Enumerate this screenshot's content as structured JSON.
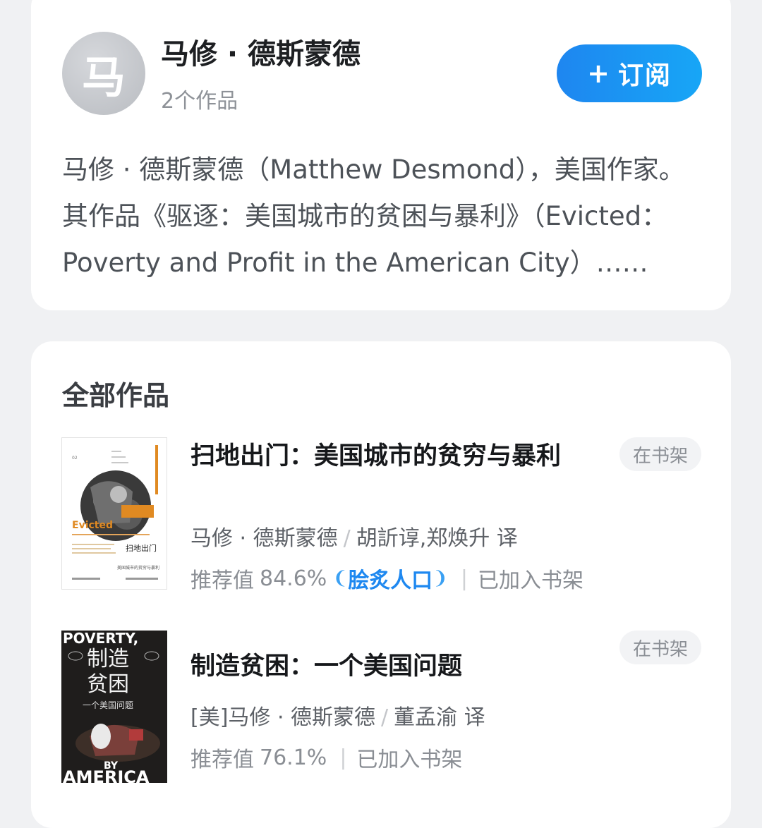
{
  "author": {
    "avatar_text": "马",
    "name": "马修 · 德斯蒙德",
    "work_count": "2个作品",
    "subscribe_plus": "+",
    "subscribe_label": "订阅",
    "bio": "马修 · 德斯蒙德（Matthew Desmond），美国作家。其作品《驱逐：美国城市的贫困与暴利》（Evicted：Poverty and Profit in the American City）……"
  },
  "works": {
    "section_title": "全部作品",
    "books": [
      {
        "title": "扫地出门：美国城市的贫穷与暴利",
        "authors": "马修 · 德斯蒙德",
        "separator": "/",
        "translators": "胡訢谆,郑焕升 译",
        "rating_label": "推荐值",
        "rating_value": "84.6%",
        "badge": "脍炙人口",
        "status": "已加入书架",
        "shelf_tag": "在书架",
        "cover": {
          "title_en": "Evicted",
          "title_cn": "扫地出门",
          "subtitle": "美国城市的贫穷与暴利"
        }
      },
      {
        "title": "制造贫困：一个美国问题",
        "authors": "[美]马修 · 德斯蒙德",
        "separator": "/",
        "translators": "董孟渝 译",
        "rating_label": "推荐值",
        "rating_value": "76.1%",
        "status": "已加入书架",
        "shelf_tag": "在书架",
        "cover": {
          "top_text": "POVERTY,",
          "title_line1": "制造",
          "title_line2": "贫困",
          "subtitle": "一个美国问题",
          "by": "BY",
          "bottom_text": "AMERICA"
        }
      }
    ]
  },
  "colors": {
    "accent": "#1e88f0",
    "page_background": "#f0f1f3",
    "card": "#ffffff"
  }
}
